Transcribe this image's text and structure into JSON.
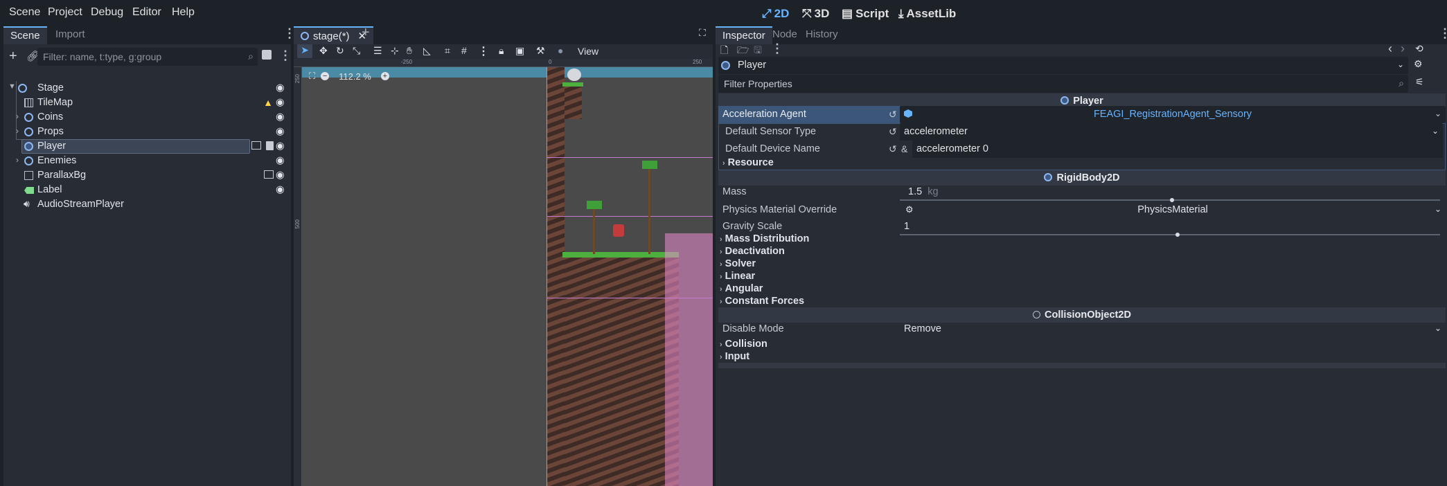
{
  "menu": {
    "items": [
      "Scene",
      "Project",
      "Debug",
      "Editor",
      "Help"
    ]
  },
  "workspaces": {
    "btn_2d": "2D",
    "btn_3d": "3D",
    "btn_script": "Script",
    "btn_assetlib": "AssetLib",
    "active": "2D"
  },
  "scene_dock": {
    "tabs": [
      "Scene",
      "Import"
    ],
    "filter_placeholder": "Filter: name, t:type, g:group",
    "nodes": [
      {
        "label": "Stage",
        "icon": "node2d-icon"
      },
      {
        "label": "TileMap",
        "icon": "tilemap-icon",
        "warning": true
      },
      {
        "label": "Coins",
        "icon": "node2d-icon"
      },
      {
        "label": "Props",
        "icon": "node2d-icon"
      },
      {
        "label": "Player",
        "icon": "rigidbody-icon",
        "selected": true
      },
      {
        "label": "Enemies",
        "icon": "node2d-icon"
      },
      {
        "label": "ParallaxBg",
        "icon": "parallax-icon"
      },
      {
        "label": "Label",
        "icon": "label-icon"
      },
      {
        "label": "AudioStreamPlayer",
        "icon": "audio-icon"
      }
    ]
  },
  "viewport": {
    "tab_label": "stage(*)",
    "view_menu": "View",
    "zoom": "112.2 %",
    "ruler_top": [
      "-250",
      "0",
      "250"
    ],
    "ruler_left": [
      "250",
      "500"
    ]
  },
  "inspector": {
    "tabs": [
      "Inspector",
      "Node",
      "History"
    ],
    "object_name": "Player",
    "filter_placeholder": "Filter Properties",
    "sections": {
      "player": "Player",
      "rigidbody": "RigidBody2D",
      "collision_object": "CollisionObject2D"
    },
    "props": {
      "acceleration_agent_label": "Acceleration Agent",
      "acceleration_agent_value": "FEAGI_RegistrationAgent_Sensory",
      "default_sensor_type_label": "Default Sensor Type",
      "default_sensor_type_value": "accelerometer",
      "default_device_name_label": "Default Device Name",
      "default_device_name_prefix": "&",
      "default_device_name_value": "accelerometer 0",
      "resource_label": "Resource",
      "mass_label": "Mass",
      "mass_value": "1.5",
      "mass_unit": "kg",
      "physics_material_label": "Physics Material Override",
      "physics_material_value": "PhysicsMaterial",
      "gravity_scale_label": "Gravity Scale",
      "gravity_scale_value": "1",
      "disable_mode_label": "Disable Mode",
      "disable_mode_value": "Remove"
    },
    "groups": [
      "Mass Distribution",
      "Deactivation",
      "Solver",
      "Linear",
      "Angular",
      "Constant Forces"
    ],
    "collision_groups": [
      "Collision",
      "Input"
    ]
  },
  "colors": {
    "accent": "#66b3ff",
    "warning": "#ffd24a",
    "selected_row": "#3b4556"
  }
}
